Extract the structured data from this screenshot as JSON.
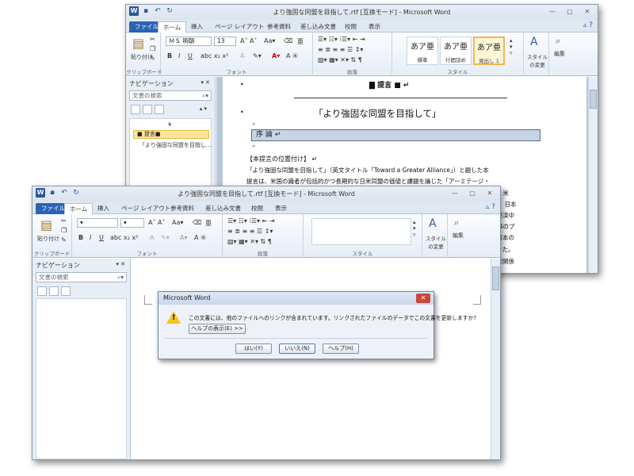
{
  "back_window": {
    "title": "より強固な同盟を目指して.rtf [互換モード] - Microsoft Word",
    "tabs": [
      "ファイル",
      "ホーム",
      "挿入",
      "ページ レイアウト",
      "参考資料",
      "差し込み文書",
      "校閲",
      "表示"
    ],
    "ribbon": {
      "paste_label": "貼り付け",
      "clipboard_group": "クリップボード",
      "font_name": "ＭＳ 明朝",
      "font_size": "13",
      "font_group": "フォント",
      "paragraph_group": "段落",
      "styles_group": "スタイル",
      "styles": [
        {
          "sample": "あア亜",
          "name": "標準"
        },
        {
          "sample": "あア亜",
          "name": "行間詰め"
        },
        {
          "sample": "あア亜",
          "name": "見出し 1"
        }
      ],
      "change_styles": "スタイルの変更",
      "edit_label": "編集"
    },
    "nav": {
      "title": "ナビゲーション",
      "search_placeholder": "文書の検索",
      "items": [
        "■ 提言■",
        "「より強固な同盟を目指し..."
      ]
    },
    "doc": {
      "heading": "提言",
      "title": "「より強固な同盟を目指して」",
      "section": "序 論",
      "para_head": "【本提言の位置付け】",
      "line1": "「より強固な同盟を目指して」（英文タイトル「Toward a Greater Alliance」）と題した本",
      "line2": "提言は、米国の識者が包括的かつ長期的な日米同盟の価値と課題を論じた「アーミテージ・",
      "frag1": "だが、米",
      "frag2": "、日本",
      "frag3": "、経済中",
      "frag4": "事のプ",
      "frag5": "、日本の",
      "frag6": "てきた。",
      "frag7": "日米関係"
    }
  },
  "front_window": {
    "title": "より強固な同盟を目指して.rtf [互換モード] - Microsoft Word",
    "tabs": [
      "ファイル",
      "ホーム",
      "挿入",
      "ページ レイアウト",
      "参考資料",
      "差し込み文書",
      "校閲",
      "表示"
    ],
    "ribbon": {
      "paste_label": "貼り付け",
      "clipboard_group": "クリップボード",
      "font_group": "フォント",
      "paragraph_group": "段落",
      "styles_group": "スタイル",
      "change_styles": "スタイルの変更",
      "edit_label": "編集"
    },
    "nav": {
      "title": "ナビゲーション",
      "search_placeholder": "文書の検索"
    }
  },
  "dialog": {
    "title": "Microsoft Word",
    "message": "この文書には、他のファイルへのリンクが含まれています。リンクされたファイルのデータでこの文書を更新しますか?",
    "help_button": "ヘルプの表示(E) >>",
    "yes_button": "はい(Y)",
    "no_button": "いいえ(N)",
    "help2_button": "ヘルプ(H)"
  },
  "colors": {
    "file_tab": "#2b63b5",
    "section_fill": "#c7d4e6",
    "warning": "#f5c518"
  }
}
